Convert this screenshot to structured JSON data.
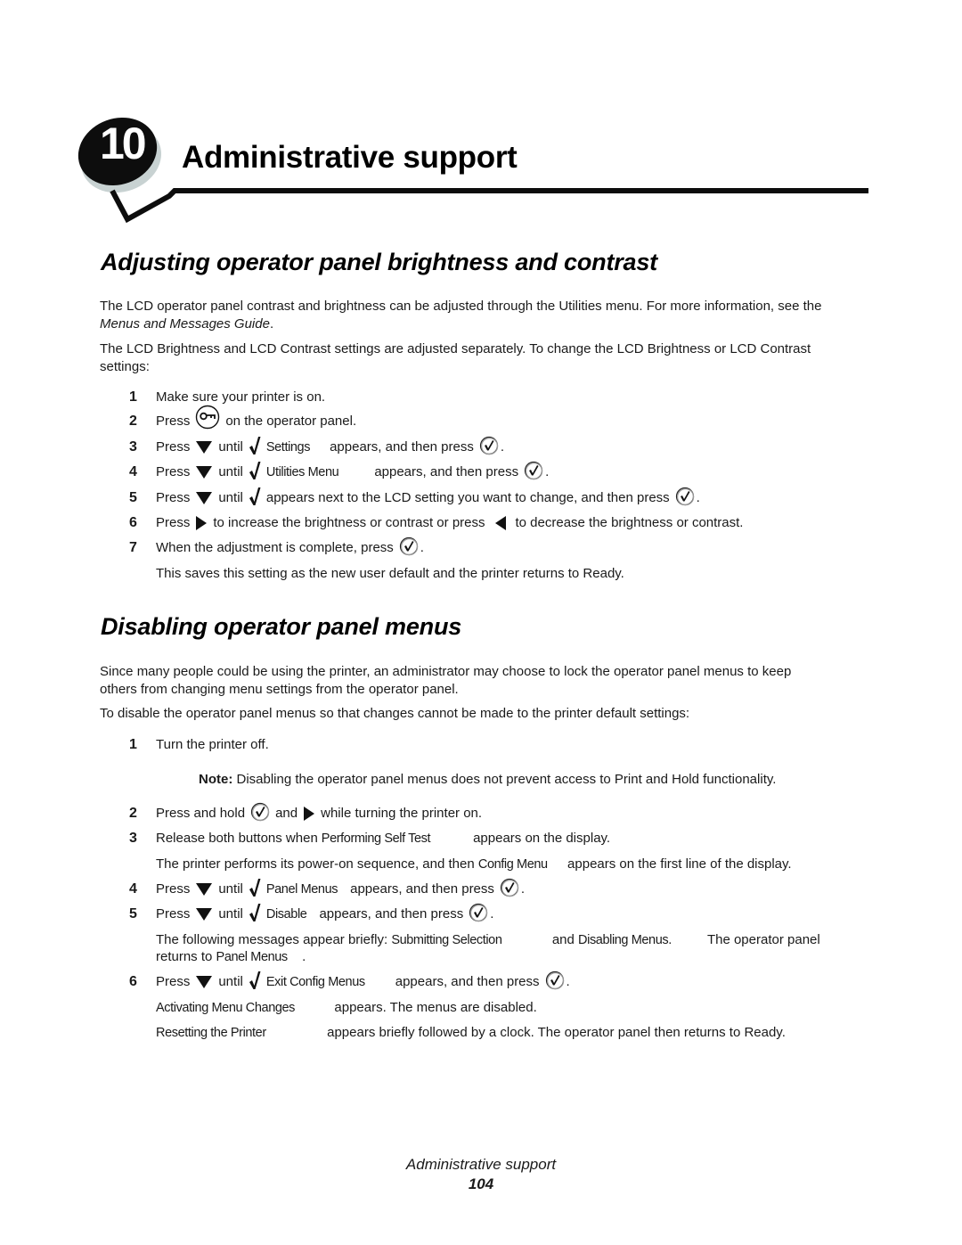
{
  "chapter": {
    "number": "10",
    "title": "Administrative support"
  },
  "section1": {
    "heading": "Adjusting operator panel brightness and contrast",
    "intro_text": "The LCD operator panel contrast and brightness can be adjusted through the Utilities menu. For more information, see the",
    "intro_ref": "Menus and Messages Guide",
    "intro_end": ".",
    "para2_line1": "The LCD Brightness and LCD Contrast settings are adjusted separately. To change the LCD Brightness or LCD Contrast",
    "para2_line2": "settings:",
    "steps": [
      {
        "n": "1",
        "text": "Make sure your printer is on."
      },
      {
        "n": "2",
        "a": "Press",
        "b": "on the operator panel."
      },
      {
        "n": "3",
        "a": "Press",
        "b": "until",
        "lcd": "Settings",
        "c": "appears, and then press",
        "d": "."
      },
      {
        "n": "4",
        "a": "Press",
        "b": "until",
        "lcd": "Utilities Menu",
        "c": "appears, and then press",
        "d": "."
      },
      {
        "n": "5",
        "a": "Press",
        "b": "until",
        "c": "appears next to the LCD setting you want to change, and then press",
        "d": "."
      },
      {
        "n": "6",
        "a": "Press",
        "b": "to increase the brightness or contrast or press",
        "c": "to decrease the brightness or contrast."
      },
      {
        "n": "7",
        "a": "When the adjustment is complete, press",
        "d": "."
      }
    ],
    "step7_result": "This saves this setting as the new user default and the printer returns to Ready."
  },
  "section2": {
    "heading": "Disabling operator panel menus",
    "para1_line1": "Since many people could be using the printer, an administrator may choose to lock the operator panel menus to keep",
    "para1_line2": "others from changing menu settings from the operator panel.",
    "para2": "To disable the operator panel menus so that changes cannot be made to the printer default settings:",
    "steps": [
      {
        "n": "1",
        "text": "Turn the printer off."
      },
      {
        "n": "2",
        "a": "Press and hold",
        "b": "and",
        "c": "while turning the printer on."
      },
      {
        "n": "3",
        "a": "Release both buttons when",
        "lcd": "Performing Self Test",
        "c": "appears on the display."
      },
      {
        "n": "4",
        "a": "Press",
        "b": "until",
        "lcd": "Panel Menus",
        "c": "appears, and then press",
        "d": "."
      },
      {
        "n": "5",
        "a": "Press",
        "b": "until",
        "lcd": "Disable",
        "c": "appears, and then press",
        "d": "."
      },
      {
        "n": "6",
        "a": "Press",
        "b": "until",
        "lcd": "Exit Config Menus",
        "c": "appears, and then press",
        "d": "."
      }
    ],
    "note_label": "Note:",
    "note_text": "Disabling the operator panel menus does not prevent access to Print and Hold functionality.",
    "step3_result_a": "The printer performs its power-on sequence, and then",
    "step3_result_lcd": "Config Menu",
    "step3_result_b": "appears on the first line of the display.",
    "step5_result_a": "The following messages appear briefly:",
    "step5_result_lcd1": "Submitting Selection",
    "step5_result_b": "and",
    "step5_result_lcd2": "Disabling Menus.",
    "step5_result_c": "The operator panel",
    "step5_result_line2_a": "returns to",
    "step5_result_line2_lcd": "Panel Menus",
    "step5_result_line2_b": ".",
    "step6_result1_lcd": "Activating Menu Changes",
    "step6_result1_text": "appears. The menus are disabled.",
    "step6_result2_lcd": "Resetting the Printer",
    "step6_result2_text": "appears briefly followed by a clock. The operator panel then returns to Ready."
  },
  "footer": {
    "title": "Administrative support",
    "page": "104"
  }
}
